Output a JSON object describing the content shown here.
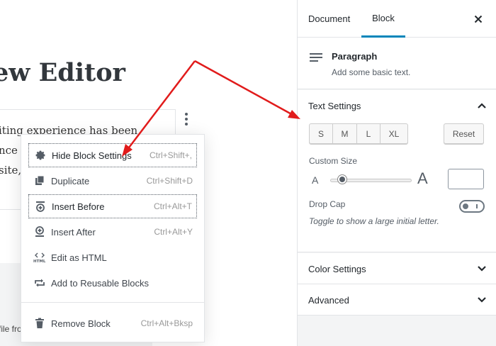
{
  "editor": {
    "title_fragment": "ew Editor",
    "paragraph_lines": [
      "iting experience has been",
      "nce t",
      "site,"
    ],
    "file_fragment": "file fro"
  },
  "block_menu": {
    "items": [
      {
        "label": "Hide Block Settings",
        "shortcut": "Ctrl+Shift+,",
        "icon": "gear-icon"
      },
      {
        "label": "Duplicate",
        "shortcut": "Ctrl+Shift+D",
        "icon": "duplicate-icon"
      },
      {
        "label": "Insert Before",
        "shortcut": "Ctrl+Alt+T",
        "icon": "insert-before-icon"
      },
      {
        "label": "Insert After",
        "shortcut": "Ctrl+Alt+Y",
        "icon": "insert-after-icon"
      },
      {
        "label": "Edit as HTML",
        "shortcut": "",
        "icon": "html-icon"
      },
      {
        "label": "Add to Reusable Blocks",
        "shortcut": "",
        "icon": "reusable-block-icon"
      },
      {
        "label": "Remove Block",
        "shortcut": "Ctrl+Alt+Bksp",
        "icon": "trash-icon"
      }
    ]
  },
  "sidebar": {
    "tabs": [
      {
        "label": "Document",
        "active": false
      },
      {
        "label": "Block",
        "active": true
      }
    ],
    "close_icon": "close-icon",
    "block_card": {
      "title": "Paragraph",
      "description": "Add some basic text.",
      "icon": "paragraph-icon"
    },
    "text_settings": {
      "title": "Text Settings",
      "sizes": [
        "S",
        "M",
        "L",
        "XL"
      ],
      "reset_label": "Reset",
      "custom_size_label": "Custom Size",
      "small_a": "A",
      "large_a": "A",
      "slider_fraction": 0.15,
      "custom_size_value": "",
      "drop_cap_label": "Drop Cap",
      "drop_cap_help": "Toggle to show a large initial letter.",
      "drop_cap_enabled": false
    },
    "color_settings": {
      "title": "Color Settings"
    },
    "advanced": {
      "title": "Advanced"
    }
  },
  "colors": {
    "accent": "#0085ba",
    "arrow": "#e11b1b"
  }
}
